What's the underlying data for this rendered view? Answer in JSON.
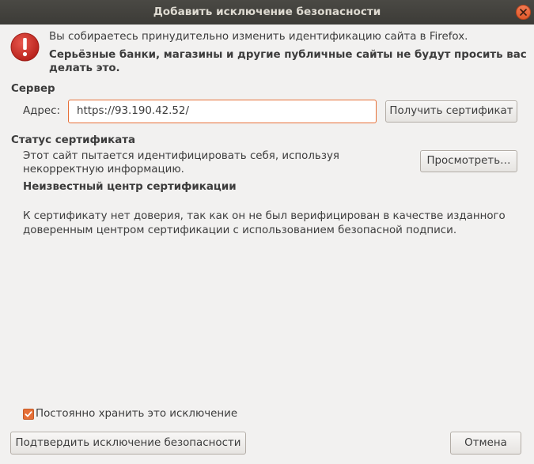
{
  "window": {
    "title": "Добавить исключение безопасности"
  },
  "warning": {
    "line1": "Вы собираетесь принудительно изменить идентификацию сайта в Firefox.",
    "line2": "Серьёзные банки, магазины и другие публичные сайты не будут просить вас",
    "line3": "делать это."
  },
  "server": {
    "heading": "Сервер",
    "address_label": "Адрес:",
    "address_value": "https://93.190.42.52/",
    "get_cert_button": "Получить сертификат"
  },
  "cert_status": {
    "heading": "Статус сертификата",
    "desc_line1": "Этот сайт пытается идентифицировать себя, используя",
    "desc_line2": "некорректную информацию.",
    "view_button": "Просмотреть…",
    "issue_title": "Неизвестный центр сертификации",
    "issue_line1": "К сертификату нет доверия, так как он не был верифицирован в качестве изданного",
    "issue_line2": "доверенным центром сертификации с использованием безопасной подписи."
  },
  "footer": {
    "permanent_checkbox_label": "Постоянно хранить это исключение",
    "permanent_checked": true,
    "confirm_button": "Подтвердить исключение безопасности",
    "cancel_button": "Отмена"
  },
  "colors": {
    "accent": "#e66f37",
    "titlebar": "#3c3b37",
    "warning_red": "#d0342c",
    "background": "#f2f1f0"
  },
  "icons": {
    "warning": "exclamation-circle-icon",
    "close": "close-icon",
    "check": "checkmark-icon"
  }
}
